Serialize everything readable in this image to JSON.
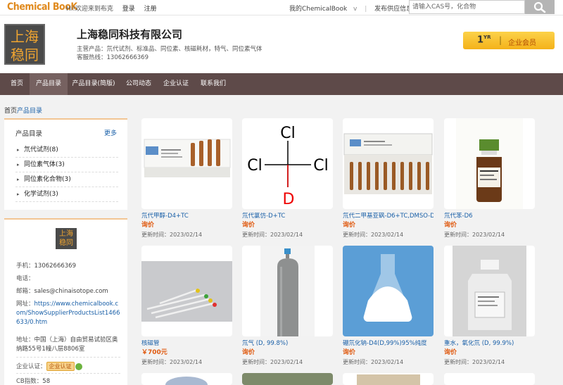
{
  "topbar": {
    "logo": "Chemical BooK",
    "welcome": "Hi!欢迎来到布克",
    "login": "登录",
    "register": "注册",
    "my_chemicalbook": "我的ChemicalBook",
    "my_chemicalbook_arrow": "v",
    "publish_supply": "发布供应信息",
    "search_placeholder": "请输入CAS号，化合物"
  },
  "header": {
    "logo_line1": "上海",
    "logo_line2": "稳同",
    "company_name": "上海稳同科技有限公司",
    "main_products": "主营产品：氘代试剂、标准品、同位素、核磁耗材，特气、同位素气体",
    "hotline": "客服热线：13062666369",
    "member_years": "1",
    "member_years_unit": "YR",
    "member_label": "企业会员",
    "member_sep": "|"
  },
  "nav": {
    "items": [
      "首页",
      "产品目录",
      "产品目录(简版)",
      "公司动态",
      "企业认证",
      "联系我们"
    ],
    "active_index": 1
  },
  "breadcrumb": {
    "home": "首页",
    "current": "产品目录"
  },
  "sidebar": {
    "catalog_title": "产品目录",
    "more": "更多",
    "categories": [
      "氘代试剂(8)",
      "同位素气体(3)",
      "同位素化合物(3)",
      "化学试剂(3)"
    ],
    "contact": {
      "logo_line1": "上海",
      "logo_line2": "稳同",
      "phone_label": "手机：",
      "phone": "13062666369",
      "tel_label": "电话：",
      "tel": "",
      "email_label": "邮箱：",
      "email": "sales@chinaisotope.com",
      "website_label": "网址：",
      "website": "https://www.chemicalbook.com/ShowSupplierProductsList1466633/0.htm",
      "address_label": "地址：",
      "address": "中国（上海）自由贸易试验区奥纳路55号1幢八层8806室",
      "cert_label": "企业认证：",
      "cert_badge": "企业认证",
      "cb_label": "CB指数：",
      "cb_value": "58"
    }
  },
  "products": [
    {
      "name": "氘代甲醇-D4+TC",
      "price": "询价",
      "updated": "更新时间：2023/02/14"
    },
    {
      "name": "氘代氯仿-D+TC",
      "price": "询价",
      "updated": "更新时间：2023/02/14"
    },
    {
      "name": "氘代二甲基亚砜-D6+TC,DMSO-D6+TC",
      "price": "询价",
      "updated": "更新时间：2023/02/14"
    },
    {
      "name": "氘代苯-D6",
      "price": "询价",
      "updated": "更新时间：2023/02/14"
    },
    {
      "name": "核磁管",
      "price": "￥700元",
      "updated": "更新时间：2023/02/14"
    },
    {
      "name": "氘气 (D, 99.8%)",
      "price": "询价",
      "updated": "更新时间：2023/02/14"
    },
    {
      "name": "硼氘化钠-D4(D,99%)95%纯度",
      "price": "询价",
      "updated": "更新时间：2023/02/14"
    },
    {
      "name": "重水，氧化氘 (D, 99.9%)",
      "price": "询价",
      "updated": "更新时间：2023/02/14"
    }
  ],
  "structure_labels": {
    "cl_top": "Cl",
    "cl_left": "Cl",
    "cl_right": "Cl",
    "d_bottom": "D"
  },
  "colors": {
    "nav_bg": "#5e4a49",
    "nav_active": "#766160",
    "link_blue": "#1a60a8",
    "price_orange": "#e05a10",
    "logo_orange": "#e08a1e",
    "member_gold": "#f4b21a"
  }
}
